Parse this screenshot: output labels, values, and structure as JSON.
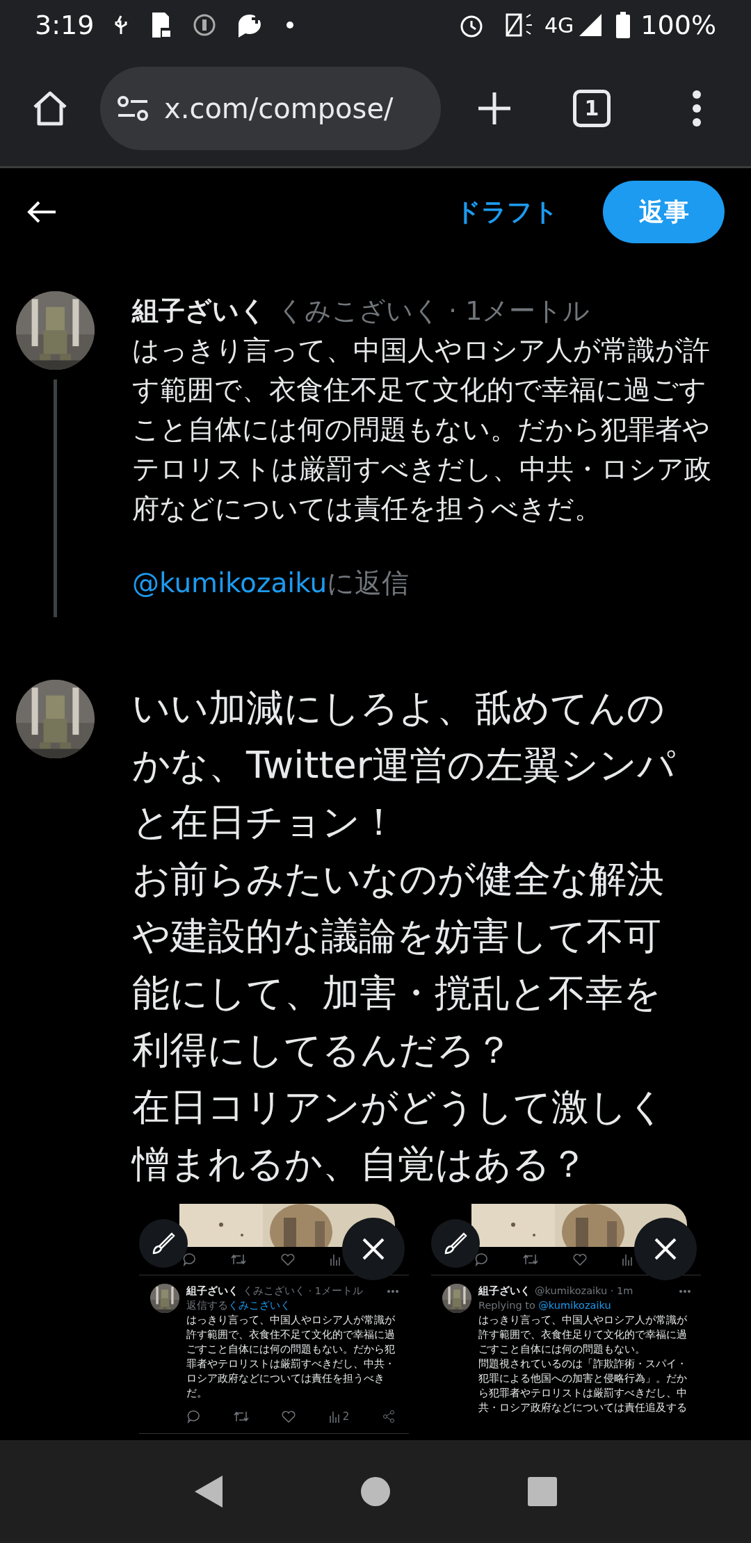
{
  "status_bar": {
    "time": "3:19",
    "network": "4G",
    "battery": "100%"
  },
  "browser": {
    "url": "x.com/compose/",
    "tab_count": "1"
  },
  "header": {
    "draft": "ドラフト",
    "reply_button": "返事"
  },
  "quoted_tweet": {
    "name": "組子ざいく",
    "meta": "くみこざいく · 1メートル",
    "text": "はっきり言って、中国人やロシア人が常識が許す範囲で、衣食住不足て文化的で幸福に過ごすこと自体には何の問題もない。だから犯罪者やテロリストは厳罰すべきだし、中共・ロシア政府などについては責任を担うべきだ。",
    "reply_handle": "@kumikozaiku",
    "reply_suffix": "に返信"
  },
  "compose": {
    "paragraphs": [
      "いい加減にしろよ、舐めてんのかな、Twitter運営の左翼シンパと在日チョン！",
      "お前らみたいなのが健全な解決や建設的な議論を妨害して不可能にして、加害・撹乱と不幸を利得にしてるんだろ？",
      "在日コリアンがどうして激しく憎まれるか、自覚はある？"
    ]
  },
  "attachments": [
    {
      "tweet": {
        "name": "組子ざいく",
        "meta": "くみこざいく · 1メートル",
        "reply_prefix": "返信する",
        "reply_target": "くみこざいく",
        "text": "はっきり言って、中国人やロシア人が常識が許す範囲で、衣食住不足て文化的で幸福に過ごすこと自体には何の問題もない。だから犯罪者やテロリストは厳罰すべきだし、中共・ロシア政府などについては責任を担うべきだ。",
        "view_count": "2"
      }
    },
    {
      "tweet": {
        "name": "組子ざいく",
        "meta": "@kumikozaiku · 1m",
        "reply_prefix": "Replying to ",
        "reply_target": "@kumikozaiku",
        "paragraphs": [
          "はっきり言って、中国人やロシア人が常識が許す範囲で、衣食住足りて文化的で幸福に過ごすこと自体には何の問題もない。",
          "問題視されているのは「詐欺詐術・スパイ・犯罪による他国への加害と侵略行為」。だから犯罪者やテロリストは厳罰すべきだし、中共・ロシア政府などについては責任追及する"
        ]
      }
    }
  ]
}
